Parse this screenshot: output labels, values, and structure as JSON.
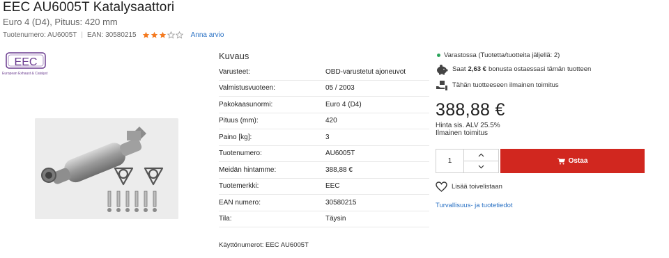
{
  "product": {
    "title": "EEC AU6005T Katalysaattori",
    "subtitle": "Euro 4 (D4), Pituus: 420 mm",
    "sku_text": "Tuotenumero: AU6005T",
    "ean_text": "EAN: 30580215",
    "rating": 3,
    "rating_max": 5,
    "review_link": "Anna arvio"
  },
  "brand_logo": {
    "text": "EEC",
    "tagline": "European Exhaust & Catalyst"
  },
  "description": {
    "title": "Kuvaus",
    "specs": [
      {
        "key": "Varusteet:",
        "value": "OBD-varustetut ajoneuvot"
      },
      {
        "key": "Valmistusvuoteen:",
        "value": "05 / 2003"
      },
      {
        "key": "Pakokaasunormi:",
        "value": "Euro 4 (D4)"
      },
      {
        "key": "Pituus (mm):",
        "value": "420"
      },
      {
        "key": "Paino [kg]:",
        "value": "3"
      },
      {
        "key": "Tuotenumero:",
        "value": "AU6005T"
      },
      {
        "key": "Meidän hintamme:",
        "value": "388,88 €"
      },
      {
        "key": "Tuotemerkki:",
        "value": "EEC"
      },
      {
        "key": "EAN numero:",
        "value": "30580215"
      },
      {
        "key": "Tila:",
        "value": "Täysin"
      }
    ],
    "usage": "Käyttönumerot: EEC AU6005T"
  },
  "purchase": {
    "stock_text": "Varastossa (Tuotetta/tuotteita jäljellä: 2)",
    "bonus_prefix": "Saat",
    "bonus_amount": "2,63 €",
    "bonus_suffix": "bonusta ostaessasi tämän tuotteen",
    "free_shipping_note": "Tähän tuotteeseen ilmainen toimitus",
    "price": "388,88 €",
    "vat_text": "Hinta sis. ALV 25.5%",
    "shipping_text": "Ilmainen toimitus",
    "quantity": "1",
    "buy_label": "Ostaa",
    "wishlist_label": "Lisää toivelistaan",
    "safety_link": "Turvallisuus- ja tuotetiedot"
  },
  "colors": {
    "accent_red": "#d1271f",
    "link_blue": "#2b72c4",
    "star_orange": "#f47a20",
    "in_stock_green": "#2aa45a",
    "logo_purple": "#6a3b8f"
  },
  "icons": [
    "star-icon",
    "piggy-bank-icon",
    "delivery-icon",
    "cart-icon",
    "heart-icon",
    "chevron-up-icon",
    "chevron-down-icon"
  ]
}
